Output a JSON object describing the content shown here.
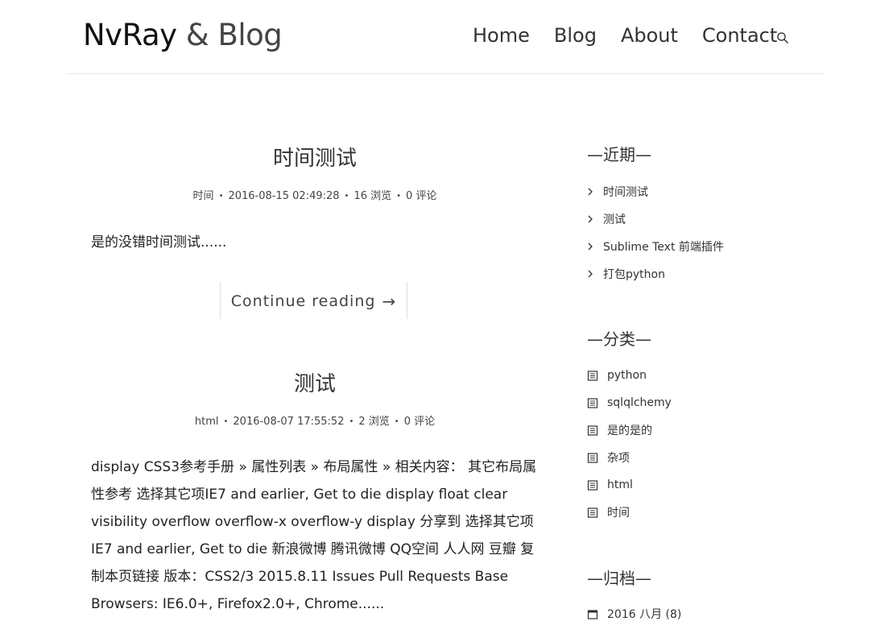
{
  "header": {
    "brand_main": "NvRay",
    "brand_amp": "&",
    "brand_rest": "Blog",
    "nav": [
      "Home",
      "Blog",
      "About",
      "Contact"
    ]
  },
  "posts": [
    {
      "title": "时间测试",
      "category": "时间",
      "date": "2016-08-15 02:49:28",
      "views": "16 浏览",
      "comments": "0 评论",
      "excerpt": "是的没错时间测试......",
      "continue_label": "Continue reading"
    },
    {
      "title": "测试",
      "category": "html",
      "date": "2016-08-07 17:55:52",
      "views": "2 浏览",
      "comments": "0 评论",
      "excerpt": "display CSS3参考手册 » 属性列表 » 布局属性 » 相关内容： 其它布局属性参考 选择其它项IE7 and earlier, Get to die display float clear visibility overflow overflow-x overflow-y display 分享到 选择其它项IE7 and earlier, Get to die 新浪微博 腾讯微博 QQ空间 人人网 豆瓣 复制本页链接 版本：CSS2/3 2015.8.11 Issues Pull Requests Base Browsers: IE6.0+, Firefox2.0+, Chrome......"
    }
  ],
  "sidebar": {
    "recent_title": "—近期—",
    "recent": [
      "时间测试",
      "测试",
      "Sublime Text 前端插件",
      "打包python"
    ],
    "categories_title": "—分类—",
    "categories": [
      "python",
      "sqlqlchemy",
      "是的是的",
      "杂项",
      "html",
      "时间"
    ],
    "archive_title": "—归档—",
    "archives": [
      "2016 八月 (8)"
    ]
  },
  "icons": {
    "search": "search-icon",
    "recent_item": "chevron-right-icon",
    "category_item": "document-list-icon",
    "archive_item": "calendar-icon",
    "continue_arrow": "arrow-right-icon"
  }
}
